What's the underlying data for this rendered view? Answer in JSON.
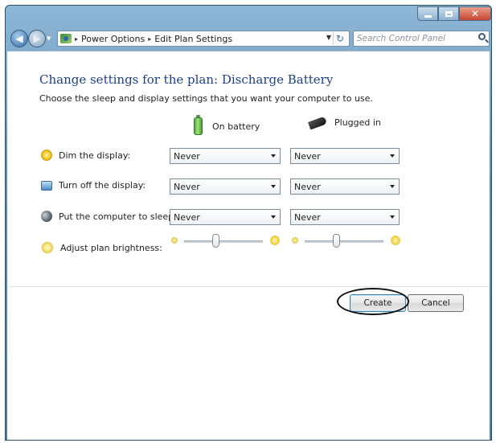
{
  "window": {
    "controls": {
      "minimize": "minimize-icon",
      "maximize": "maximize-icon",
      "close": "close-icon"
    }
  },
  "address": {
    "breadcrumbs": [
      "Power Options",
      "Edit Plan Settings"
    ],
    "search_placeholder": "Search Control Panel"
  },
  "page": {
    "title": "Change settings for the plan: Discharge Battery",
    "description": "Choose the sleep and display settings that you want your computer to use."
  },
  "columns": {
    "on_battery": "On battery",
    "plugged_in": "Plugged in"
  },
  "settings": [
    {
      "label": "Dim the display:",
      "on_battery": "Never",
      "plugged_in": "Never",
      "icon": "sun-icon"
    },
    {
      "label": "Turn off the display:",
      "on_battery": "Never",
      "plugged_in": "Never",
      "icon": "monitor-icon"
    },
    {
      "label": "Put the computer to sleep:",
      "on_battery": "Never",
      "plugged_in": "Never",
      "icon": "moon-icon"
    }
  ],
  "brightness": {
    "label": "Adjust plan brightness:",
    "on_battery_level": 0.4,
    "plugged_in_level": 0.4
  },
  "buttons": {
    "create": "Create",
    "cancel": "Cancel"
  }
}
